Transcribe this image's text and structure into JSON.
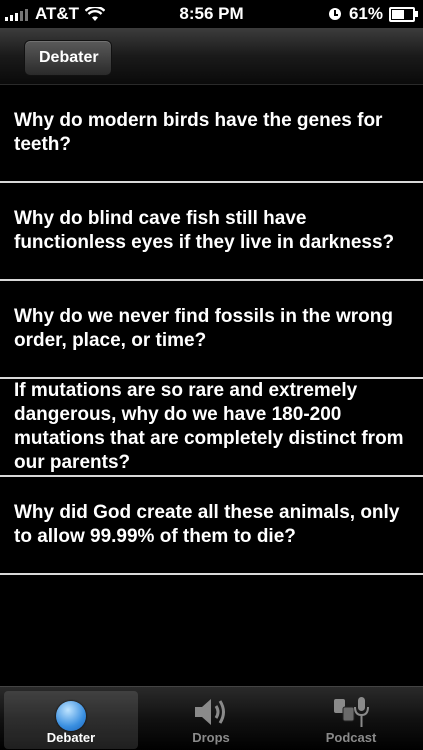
{
  "status_bar": {
    "carrier": "AT&T",
    "time": "8:56 PM",
    "battery_percent": "61%",
    "battery_level": 0.61
  },
  "nav": {
    "back_label": "Debater"
  },
  "questions": [
    "Why do modern birds have the genes for teeth?",
    "Why do blind cave fish still have functionless eyes if they live in darkness?",
    "Why do we never find fossils in the wrong order, place, or time?",
    "If mutations are so rare and extremely dangerous, why do we have 180-200 mutations that are completely distinct from our parents?",
    "Why did God create all these animals, only to allow 99.99% of them to die?"
  ],
  "tabs": [
    {
      "label": "Debater",
      "icon": "globe-icon",
      "active": true
    },
    {
      "label": "Drops",
      "icon": "speaker-icon",
      "active": false
    },
    {
      "label": "Podcast",
      "icon": "podcast-icon",
      "active": false
    }
  ],
  "colors": {
    "background": "#000000",
    "divider": "#d8d8d8",
    "active_tab_icon": "#3a8fe0"
  }
}
